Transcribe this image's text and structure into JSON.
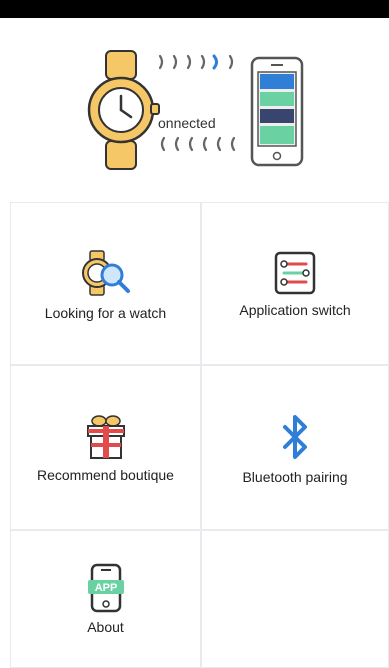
{
  "hero": {
    "status_text": "onnected",
    "top_signal": ") ) ) ) )",
    "bottom_signal": "( ( ( ( ("
  },
  "menu": {
    "items": [
      {
        "label": "Looking for a watch",
        "icon": "watch-search-icon"
      },
      {
        "label": "Application switch",
        "icon": "settings-list-icon"
      },
      {
        "label": "Recommend boutique",
        "icon": "gift-icon"
      },
      {
        "label": "Bluetooth pairing",
        "icon": "bluetooth-icon"
      },
      {
        "label": "About",
        "icon": "app-phone-icon"
      }
    ]
  },
  "colors": {
    "watch_body": "#f6c766",
    "watch_face": "#ffffff",
    "accent_blue": "#2f7fd6",
    "accent_green": "#6ad2a2",
    "accent_red": "#e24b4b",
    "phone_frame": "#555555"
  }
}
